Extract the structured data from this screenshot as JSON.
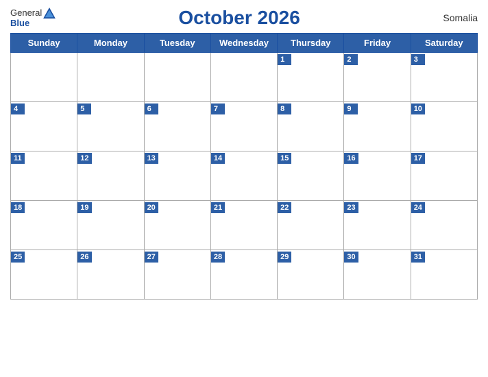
{
  "header": {
    "logo": {
      "general": "General",
      "blue": "Blue"
    },
    "title": "October 2026",
    "country": "Somalia"
  },
  "days": [
    "Sunday",
    "Monday",
    "Tuesday",
    "Wednesday",
    "Thursday",
    "Friday",
    "Saturday"
  ],
  "weeks": [
    [
      null,
      null,
      null,
      null,
      1,
      2,
      3
    ],
    [
      4,
      5,
      6,
      7,
      8,
      9,
      10
    ],
    [
      11,
      12,
      13,
      14,
      15,
      16,
      17
    ],
    [
      18,
      19,
      20,
      21,
      22,
      23,
      24
    ],
    [
      25,
      26,
      27,
      28,
      29,
      30,
      31
    ]
  ]
}
